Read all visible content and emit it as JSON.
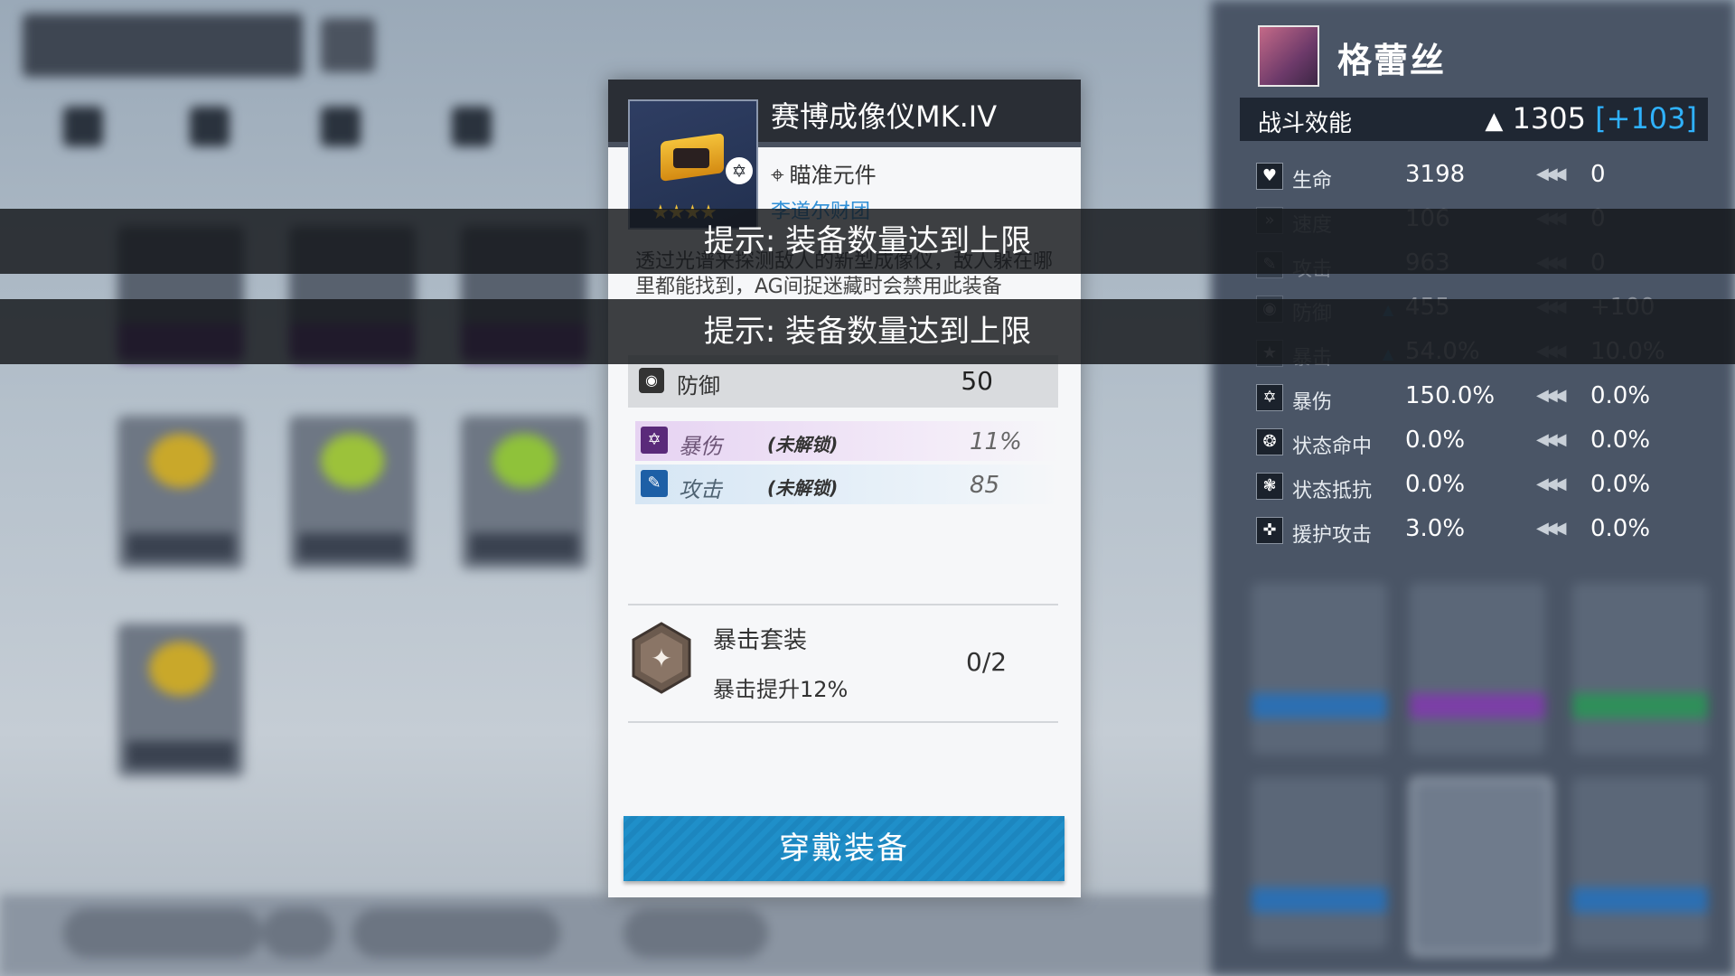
{
  "character": {
    "name": "格蕾丝",
    "power_label": "战斗效能",
    "power_value": "1305",
    "power_bonus": "[+103]"
  },
  "stats": [
    {
      "name": "生命",
      "value": "3198",
      "bonus": "0",
      "icon": "heart-icon",
      "glyph": "♥"
    },
    {
      "name": "速度",
      "value": "106",
      "bonus": "0",
      "icon": "speed-icon",
      "glyph": "»"
    },
    {
      "name": "攻击",
      "value": "963",
      "bonus": "0",
      "icon": "attack-icon",
      "glyph": "✎"
    },
    {
      "name": "防御",
      "value": "455",
      "bonus": "+100",
      "icon": "defense-icon",
      "glyph": "◉"
    },
    {
      "name": "暴击",
      "value": "54.0%",
      "bonus": "10.0%",
      "icon": "crit-icon",
      "glyph": "★"
    },
    {
      "name": "暴伤",
      "value": "150.0%",
      "bonus": "0.0%",
      "icon": "crit-damage-icon",
      "glyph": "✡"
    },
    {
      "name": "状态命中",
      "value": "0.0%",
      "bonus": "0.0%",
      "icon": "effect-hit-icon",
      "glyph": "❂"
    },
    {
      "name": "状态抵抗",
      "value": "0.0%",
      "bonus": "0.0%",
      "icon": "effect-resist-icon",
      "glyph": "❃"
    },
    {
      "name": "援护攻击",
      "value": "3.0%",
      "bonus": "0.0%",
      "icon": "support-attack-icon",
      "glyph": "✜"
    }
  ],
  "item": {
    "name": "赛博成像仪MK.IV",
    "type": "瞄准元件",
    "maker": "李道尔财团",
    "stars": "★★★★",
    "description": "透过光谱来探测敌人的新型成像仪，敌人躲在哪里都能找到，AG间捉迷藏时会禁用此装备",
    "main_stat": {
      "name": "防御",
      "value": "50"
    },
    "sub_stats": [
      {
        "name": "暴伤",
        "lock": "(未解锁)",
        "value": "11%",
        "color": "#5a2a7a",
        "glyph": "✡"
      },
      {
        "name": "攻击",
        "lock": "(未解锁)",
        "value": "85",
        "color": "#1d5fa6",
        "glyph": "✎"
      }
    ],
    "set": {
      "name": "暴击套装",
      "desc": "暴击提升12%",
      "count": "0/2"
    },
    "equip_label": "穿戴装备"
  },
  "toasts": [
    "提示: 装备数量达到上限",
    "提示: 装备数量达到上限"
  ],
  "colors": {
    "accent": "#1f8fc9",
    "bonus": "#2fb2ff",
    "header": "#2a2e35"
  }
}
